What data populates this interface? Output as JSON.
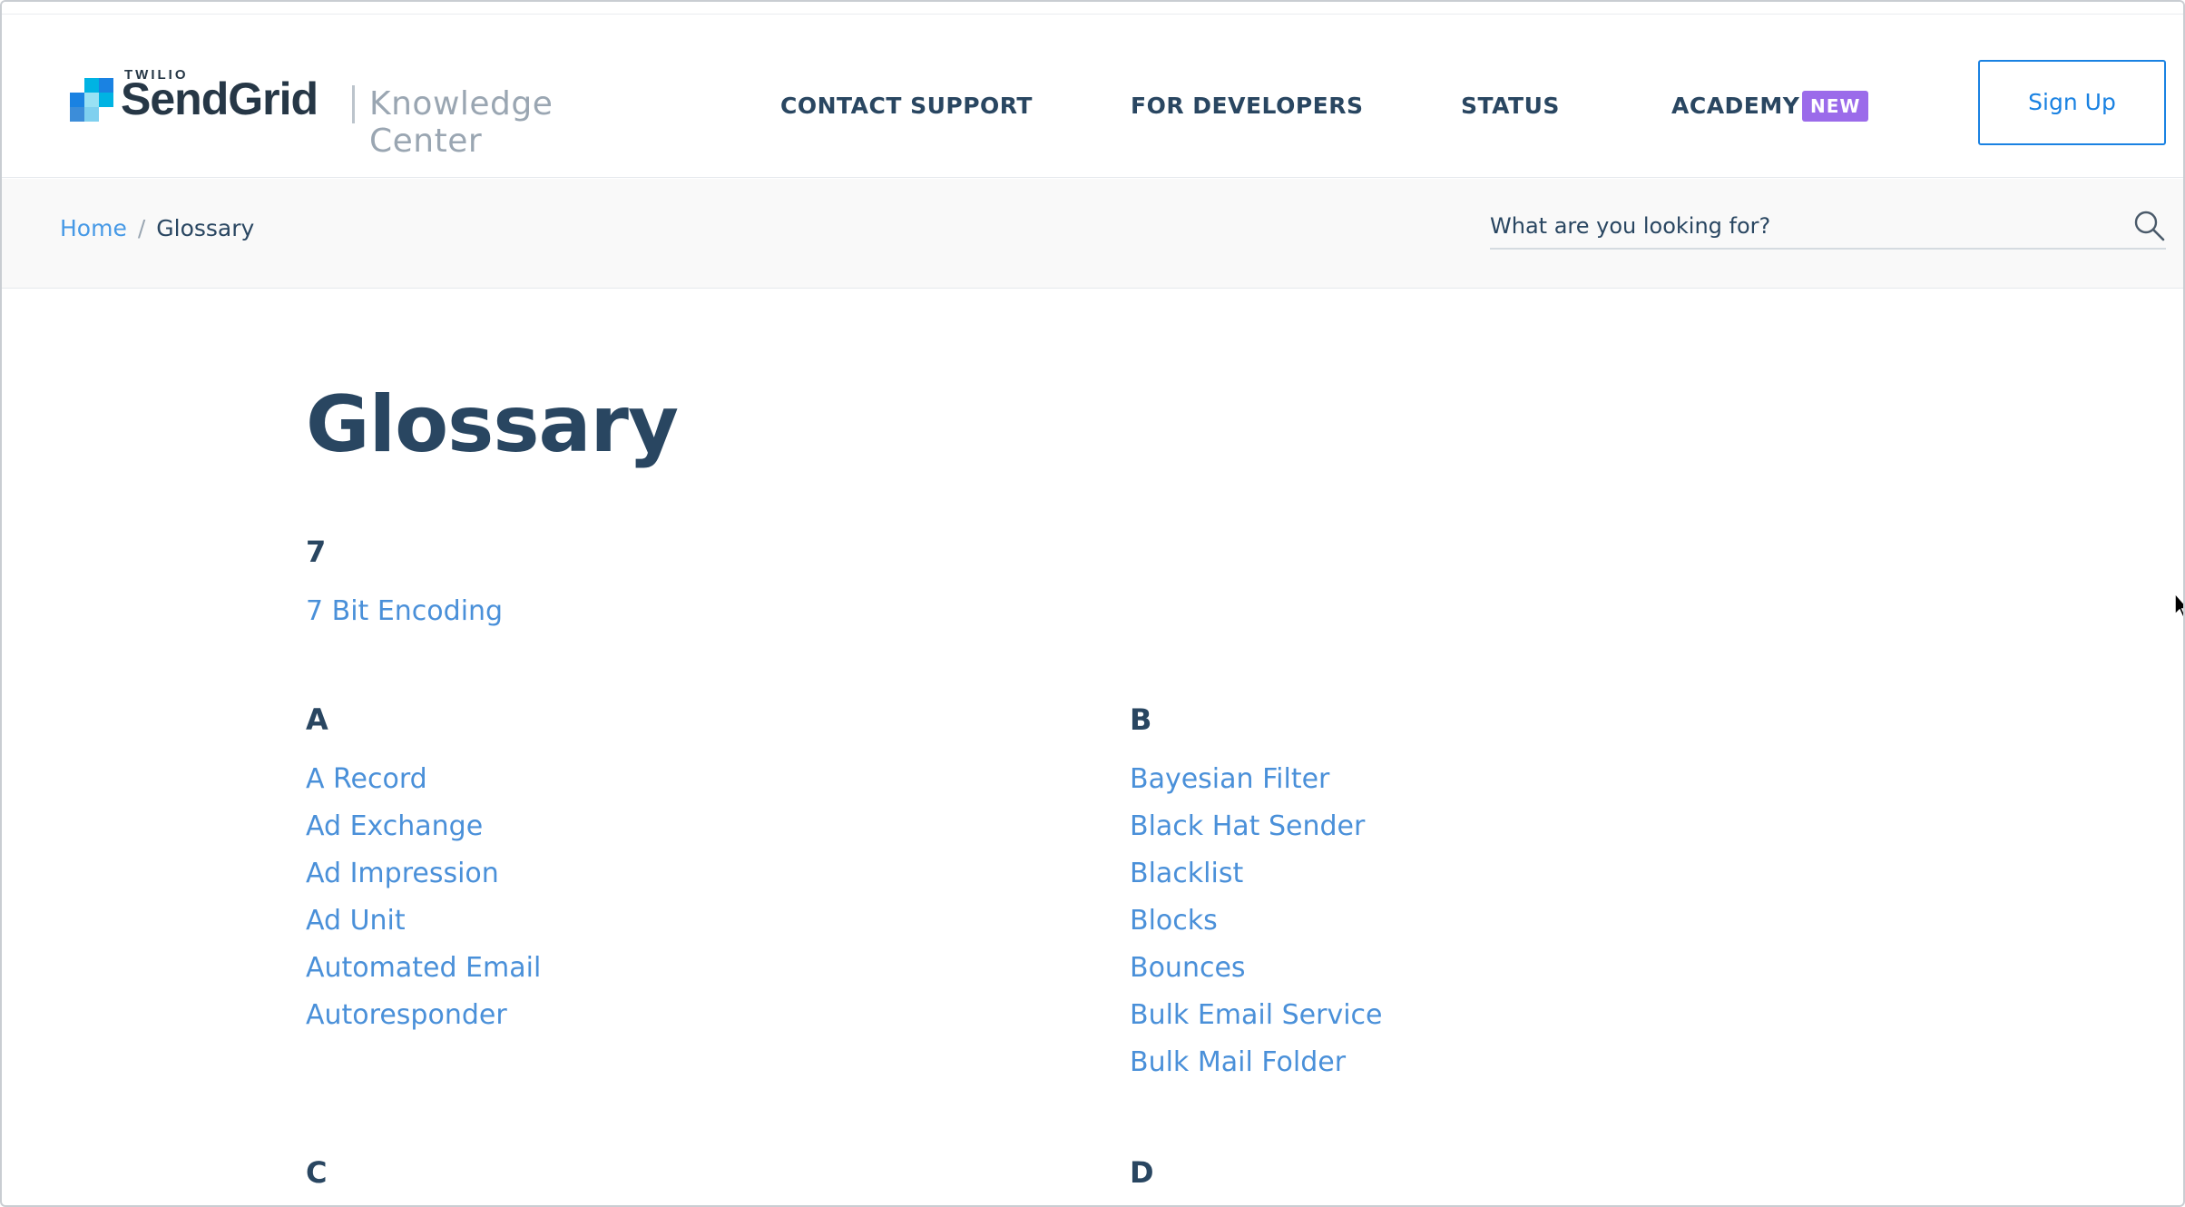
{
  "header": {
    "logo": {
      "twilio": "TWILIO",
      "brand": "SendGrid",
      "section_name": "Knowledge Center",
      "mark_colors": [
        "#1a82e2",
        "#00b3e3",
        "#99e1f4",
        "#3c8dd9",
        "#7fd0ef"
      ]
    },
    "nav": {
      "contact_support": "CONTACT SUPPORT",
      "for_developers": "FOR DEVELOPERS",
      "status": "STATUS",
      "academy": "ACADEMY",
      "academy_badge": "NEW"
    },
    "signup_label": "Sign Up"
  },
  "breadcrumb": {
    "home": "Home",
    "separator": "/",
    "current": "Glossary"
  },
  "search": {
    "placeholder": "What are you looking for?",
    "icon": "search-icon"
  },
  "main": {
    "title": "Glossary",
    "sections": {
      "s7": {
        "letter": "7",
        "terms": [
          "7 Bit Encoding"
        ]
      },
      "sA": {
        "letter": "A",
        "terms": [
          "A Record",
          "Ad Exchange",
          "Ad Impression",
          "Ad Unit",
          "Automated Email",
          "Autoresponder"
        ]
      },
      "sB": {
        "letter": "B",
        "terms": [
          "Bayesian Filter",
          "Black Hat Sender",
          "Blacklist",
          "Blocks",
          "Bounces",
          "Bulk Email Service",
          "Bulk Mail Folder"
        ]
      },
      "sC": {
        "letter": "C",
        "terms": []
      },
      "sD": {
        "letter": "D",
        "terms": []
      }
    }
  },
  "colors": {
    "heading": "#294661",
    "link": "#4a90d9",
    "accent_blue": "#1a82e2",
    "badge_purple": "#9b6bea"
  }
}
